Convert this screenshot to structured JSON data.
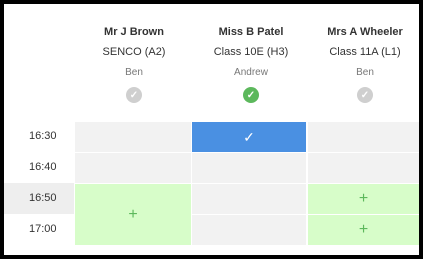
{
  "columns": [
    {
      "teacher": "Mr J Brown",
      "class": "SENCO (A2)",
      "student": "Ben",
      "status": "unselected"
    },
    {
      "teacher": "Miss B Patel",
      "class": "Class 10E (H3)",
      "student": "Andrew",
      "status": "selected"
    },
    {
      "teacher": "Mrs A Wheeler",
      "class": "Class 11A (L1)",
      "student": "Ben",
      "status": "unselected"
    }
  ],
  "times": [
    "16:30",
    "16:40",
    "16:50",
    "17:00"
  ],
  "icons": {
    "check": "✓",
    "plus": "+"
  },
  "colors": {
    "booked": "#4a90e2",
    "available": "#d7fdc9",
    "available_icon": "#5cb85c",
    "unavailable": "#f2f2f2"
  }
}
